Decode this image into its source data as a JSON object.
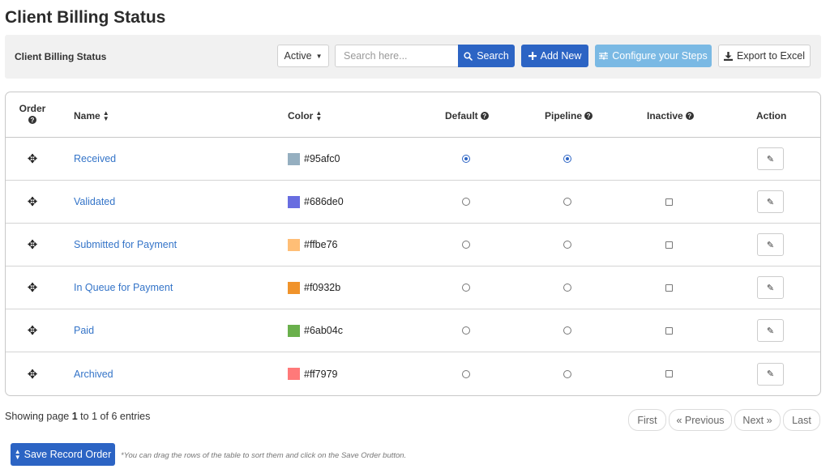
{
  "page": {
    "title": "Client Billing Status"
  },
  "toolbar": {
    "title": "Client Billing Status",
    "filter_label": "Active",
    "search_placeholder": "Search here...",
    "search_label": "Search",
    "add_label": "Add New",
    "configure_label": "Configure your Steps",
    "export_label": "Export to Excel"
  },
  "table": {
    "headers": {
      "order": "Order",
      "name": "Name",
      "color": "Color",
      "default": "Default",
      "pipeline": "Pipeline",
      "inactive": "Inactive",
      "action": "Action"
    },
    "rows": [
      {
        "name": "Received",
        "color": "#95afc0",
        "default": true,
        "pipeline": true,
        "inactive_shown": false
      },
      {
        "name": "Validated",
        "color": "#686de0",
        "default": false,
        "pipeline": false,
        "inactive_shown": true
      },
      {
        "name": "Submitted for Payment",
        "color": "#ffbe76",
        "default": false,
        "pipeline": false,
        "inactive_shown": true
      },
      {
        "name": "In Queue for Payment",
        "color": "#f0932b",
        "default": false,
        "pipeline": false,
        "inactive_shown": true
      },
      {
        "name": "Paid",
        "color": "#6ab04c",
        "default": false,
        "pipeline": false,
        "inactive_shown": true
      },
      {
        "name": "Archived",
        "color": "#ff7979",
        "default": false,
        "pipeline": false,
        "inactive_shown": true
      }
    ]
  },
  "pagination": {
    "info_prefix": "Showing page",
    "current_page": "1",
    "to_word": "to",
    "last_page": "1",
    "of_word": "of",
    "entries_text": "6 entries",
    "first": "First",
    "previous": "« Previous",
    "next": "Next »",
    "last": "Last"
  },
  "footer": {
    "save_label": "Save Record Order",
    "hint": "*You can drag the rows of the table to sort them and click on the Save Order button."
  },
  "icons": {
    "search": "search-icon",
    "add": "plus-icon",
    "configure": "sliders-icon",
    "export": "download-icon",
    "drag": "move-icon",
    "edit": "edit-icon",
    "sort": "sort-icon",
    "info": "question-circle-icon"
  },
  "colors": {
    "primary": "#2c64c4",
    "link": "#3474c8",
    "configure": "#7ab9e4"
  }
}
